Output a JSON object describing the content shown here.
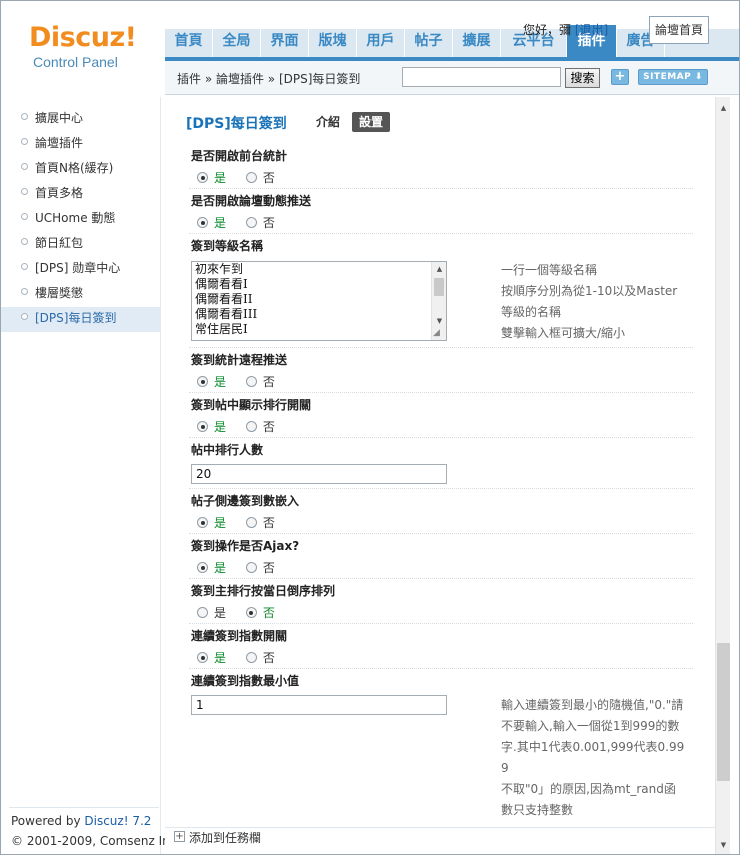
{
  "logo": {
    "main": "Discuz!",
    "sub": "Control Panel"
  },
  "userbar": {
    "greeting": "您好，",
    "username": "彌",
    "logout": "[退出]"
  },
  "header": {
    "forum_home": "論壇首頁"
  },
  "nav": {
    "items": [
      {
        "label": "首頁"
      },
      {
        "label": "全局"
      },
      {
        "label": "界面"
      },
      {
        "label": "版塊"
      },
      {
        "label": "用戶"
      },
      {
        "label": "帖子"
      },
      {
        "label": "擴展"
      },
      {
        "label": "云平台"
      },
      {
        "label": "插件"
      },
      {
        "label": "廣告"
      }
    ]
  },
  "breadcrumb": {
    "text": "插件 » 論壇插件 » [DPS]每日簽到"
  },
  "search": {
    "value": "",
    "button": "搜索"
  },
  "toolbar": {
    "plus": "+",
    "sitemap": "SITEMAP ⬇"
  },
  "sidebar": {
    "items": [
      {
        "label": "擴展中心"
      },
      {
        "label": "論壇插件"
      },
      {
        "label": "首頁N格(緩存)"
      },
      {
        "label": "首頁多格"
      },
      {
        "label": "UCHome 動態"
      },
      {
        "label": "節日紅包"
      },
      {
        "label": "[DPS] 勋章中心"
      },
      {
        "label": "樓層獎懲"
      },
      {
        "label": "[DPS]每日簽到"
      }
    ]
  },
  "footer": {
    "powered_prefix": "Powered by ",
    "powered_brand": "Discuz! 7.2",
    "copyright": "© 2001-2009, Comsenz Inc."
  },
  "main": {
    "plugin_title": "[DPS]每日簽到",
    "tab_intro": "介紹",
    "tab_settings": "設置",
    "yes": "是",
    "no": "否",
    "settings": [
      {
        "label": "是否開啟前台統計"
      },
      {
        "label": "是否開啟論壇動態推送"
      },
      {
        "label": "簽到等級名稱"
      },
      {
        "label": "簽到統計遠程推送"
      },
      {
        "label": "簽到帖中顯示排行開關"
      },
      {
        "label": "帖中排行人數"
      },
      {
        "label": "帖子側邊簽到數嵌入"
      },
      {
        "label": "簽到操作是否Ajax?"
      },
      {
        "label": "簽到主排行按當日倒序排列"
      },
      {
        "label": "連續簽到指數開關"
      },
      {
        "label": "連續簽到指數最小值"
      }
    ],
    "level_names": [
      "初來乍到",
      "偶爾看看I",
      "偶爾看看II",
      "偶爾看看III",
      "常住居民I"
    ],
    "level_hint": [
      "一行一個等級名稱",
      "按順序分別為從1-10以及Master",
      "等級的名稱",
      "雙擊輸入框可擴大/縮小"
    ],
    "rank_count": "20",
    "min_value": "1",
    "min_hint": [
      "輸入連續簽到最小的隨機值,\"0.\"請",
      "不要輸入,輸入一個從1到999的數",
      "字.其中1代表0.001,999代表0.99",
      "9",
      "不取\"0」的原因,因為mt_rand函",
      "數只支持整數"
    ]
  },
  "bottom": {
    "add_task": "添加到任務欄",
    "add_icon": "+"
  }
}
